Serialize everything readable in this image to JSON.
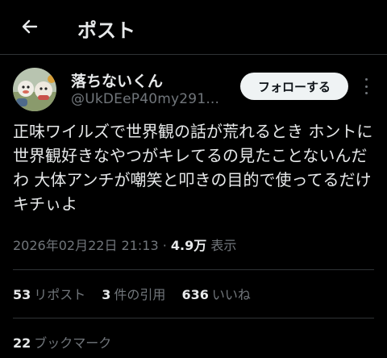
{
  "header": {
    "title": "ポスト",
    "back_icon": "arrow-left-icon"
  },
  "author": {
    "display_name": "落ちないくん",
    "handle": "@UkDEeP40my291...",
    "follow_label": "フォローする"
  },
  "tweet": {
    "text": "正味ワイルズで世界観の話が荒れるとき ホントに世界観好きなやつがキレてるの見たことないんだわ 大体アンチが嘲笑と叩きの目的で使ってるだけ キチぃよ"
  },
  "meta": {
    "timestamp": "2026年02月22日 21:13",
    "separator": "·",
    "views_count": "4.9万",
    "views_label": "表示"
  },
  "stats": {
    "reposts_count": "53",
    "reposts_label": "リポスト",
    "quotes_count": "3",
    "quotes_label": "件の引用",
    "likes_count": "636",
    "likes_label": "いいね",
    "bookmarks_count": "22",
    "bookmarks_label": "ブックマーク"
  },
  "colors": {
    "background": "#000000",
    "text_primary": "#e7e9ea",
    "text_secondary": "#71767b",
    "divider": "#2f3336",
    "follow_button_bg": "#eff3f4"
  }
}
